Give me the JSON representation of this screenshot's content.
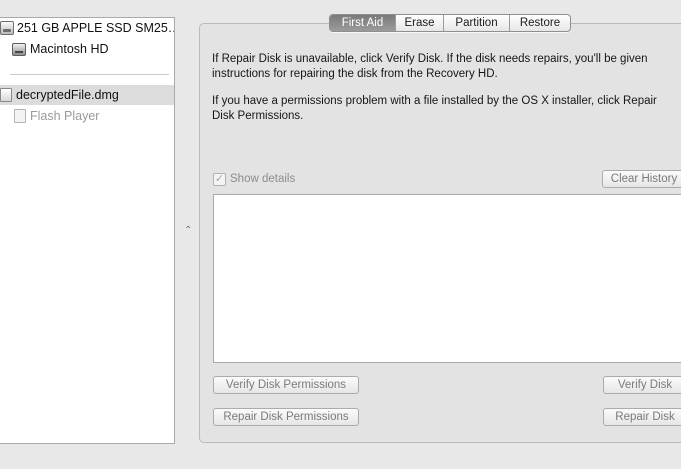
{
  "sidebar": {
    "items": [
      {
        "label": "251 GB APPLE SSD SM25…"
      },
      {
        "label": "Macintosh HD"
      },
      {
        "label": "decryptedFile.dmg"
      },
      {
        "label": "Flash Player"
      }
    ]
  },
  "tabs": [
    {
      "label": "First Aid"
    },
    {
      "label": "Erase"
    },
    {
      "label": "Partition"
    },
    {
      "label": "Restore"
    }
  ],
  "first_aid": {
    "paragraph1": "If Repair Disk is unavailable, click Verify Disk. If the disk needs repairs, you'll be given instructions for repairing the disk from the Recovery HD.",
    "paragraph2": "If you have a permissions problem with a file installed by the OS X installer, click Repair Disk Permissions.",
    "show_details_label": "Show details",
    "clear_history_label": "Clear History",
    "verify_permissions_label": "Verify Disk Permissions",
    "repair_permissions_label": "Repair Disk Permissions",
    "verify_disk_label": "Verify Disk",
    "repair_disk_label": "Repair Disk"
  },
  "colors": {
    "background": "#e8e8e8",
    "selection": "#dcdcdc",
    "active_tab": "#8a8a8a",
    "disabled_text": "#7a7a7a"
  }
}
